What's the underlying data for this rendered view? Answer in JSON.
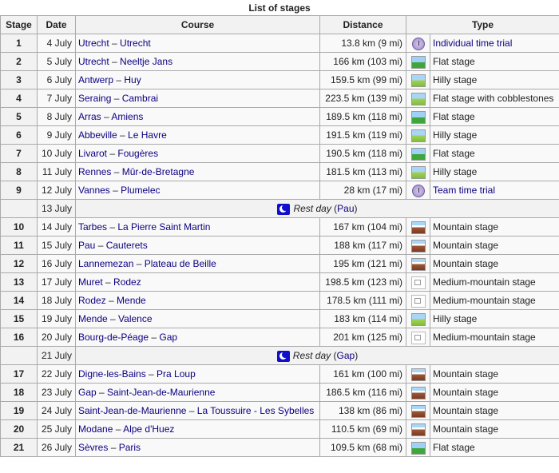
{
  "caption": "List of stages",
  "headers": {
    "stage": "Stage",
    "date": "Date",
    "course": "Course",
    "distance": "Distance",
    "type": "Type"
  },
  "rows": [
    {
      "stage": "1",
      "date": "4 July",
      "from": "Utrecht",
      "to": "Utrecht",
      "distance": "13.8 km (9 mi)",
      "icon": "clock-icon",
      "type": "Individual time trial",
      "type_link": true
    },
    {
      "stage": "2",
      "date": "5 July",
      "from": "Utrecht",
      "to": "Neeltje Jans",
      "distance": "166 km (103 mi)",
      "icon": "flat-stage-icon",
      "type": "Flat stage",
      "type_link": false
    },
    {
      "stage": "3",
      "date": "6 July",
      "from": "Antwerp",
      "to": "Huy",
      "distance": "159.5 km (99 mi)",
      "icon": "hilly-stage-icon",
      "type": "Hilly stage",
      "type_link": false
    },
    {
      "stage": "4",
      "date": "7 July",
      "from": "Seraing",
      "to": "Cambrai",
      "distance": "223.5 km (139 mi)",
      "icon": "hilly-stage-icon",
      "type": "Flat stage with cobblestones",
      "type_link": false
    },
    {
      "stage": "5",
      "date": "8 July",
      "from": "Arras",
      "to": "Amiens",
      "distance": "189.5 km (118 mi)",
      "icon": "flat-stage-icon",
      "type": "Flat stage",
      "type_link": false
    },
    {
      "stage": "6",
      "date": "9 July",
      "from": "Abbeville",
      "to": "Le Havre",
      "distance": "191.5 km (119 mi)",
      "icon": "hilly-stage-icon",
      "type": "Hilly stage",
      "type_link": false
    },
    {
      "stage": "7",
      "date": "10 July",
      "from": "Livarot",
      "to": "Fougères",
      "distance": "190.5 km (118 mi)",
      "icon": "flat-stage-icon",
      "type": "Flat stage",
      "type_link": false
    },
    {
      "stage": "8",
      "date": "11 July",
      "from": "Rennes",
      "to": "Mûr-de-Bretagne",
      "distance": "181.5 km (113 mi)",
      "icon": "hilly-stage-icon",
      "type": "Hilly stage",
      "type_link": false
    },
    {
      "stage": "9",
      "date": "12 July",
      "from": "Vannes",
      "to": "Plumelec",
      "distance": "28 km (17 mi)",
      "icon": "clock-icon",
      "type": "Team time trial",
      "type_link": true
    },
    {
      "rest": true,
      "date": "13 July",
      "label": "Rest day",
      "place": "Pau"
    },
    {
      "stage": "10",
      "date": "14 July",
      "from": "Tarbes",
      "to": "La Pierre Saint Martin",
      "distance": "167 km (104 mi)",
      "icon": "mountain-stage-icon",
      "type": "Mountain stage",
      "type_link": false
    },
    {
      "stage": "11",
      "date": "15 July",
      "from": "Pau",
      "to": "Cauterets",
      "distance": "188 km (117 mi)",
      "icon": "mountain-stage-icon",
      "type": "Mountain stage",
      "type_link": false
    },
    {
      "stage": "12",
      "date": "16 July",
      "from": "Lannemezan",
      "to": "Plateau de Beille",
      "distance": "195 km (121 mi)",
      "icon": "mountain-stage-icon",
      "type": "Mountain stage",
      "type_link": false
    },
    {
      "stage": "13",
      "date": "17 July",
      "from": "Muret",
      "to": "Rodez",
      "distance": "198.5 km (123 mi)",
      "icon": "medium-mountain-stage-icon",
      "type": "Medium-mountain stage",
      "type_link": false
    },
    {
      "stage": "14",
      "date": "18 July",
      "from": "Rodez",
      "to": "Mende",
      "distance": "178.5 km (111 mi)",
      "icon": "medium-mountain-stage-icon",
      "type": "Medium-mountain stage",
      "type_link": false
    },
    {
      "stage": "15",
      "date": "19 July",
      "from": "Mende",
      "to": "Valence",
      "distance": "183 km (114 mi)",
      "icon": "hilly-stage-icon",
      "type": "Hilly stage",
      "type_link": false
    },
    {
      "stage": "16",
      "date": "20 July",
      "from": "Bourg-de-Péage",
      "to": "Gap",
      "distance": "201 km (125 mi)",
      "icon": "medium-mountain-stage-icon",
      "type": "Medium-mountain stage",
      "type_link": false
    },
    {
      "rest": true,
      "date": "21 July",
      "label": "Rest day",
      "place": "Gap"
    },
    {
      "stage": "17",
      "date": "22 July",
      "from": "Digne-les-Bains",
      "to": "Pra Loup",
      "distance": "161 km (100 mi)",
      "icon": "mountain-stage-icon",
      "type": "Mountain stage",
      "type_link": false
    },
    {
      "stage": "18",
      "date": "23 July",
      "from": "Gap",
      "to": "Saint-Jean-de-Maurienne",
      "distance": "186.5 km (116 mi)",
      "icon": "mountain-stage-icon",
      "type": "Mountain stage",
      "type_link": false
    },
    {
      "stage": "19",
      "date": "24 July",
      "from": "Saint-Jean-de-Maurienne",
      "to": "La Toussuire - Les Sybelles",
      "distance": "138 km (86 mi)",
      "icon": "mountain-stage-icon",
      "type": "Mountain stage",
      "type_link": false
    },
    {
      "stage": "20",
      "date": "25 July",
      "from": "Modane",
      "to": "Alpe d'Huez",
      "distance": "110.5 km (69 mi)",
      "icon": "mountain-stage-icon",
      "type": "Mountain stage",
      "type_link": false
    },
    {
      "stage": "21",
      "date": "26 July",
      "from": "Sèvres",
      "to": "Paris",
      "distance": "109.5 km (68 mi)",
      "icon": "flat-stage-icon",
      "type": "Flat stage",
      "type_link": false
    }
  ],
  "separator": " – "
}
